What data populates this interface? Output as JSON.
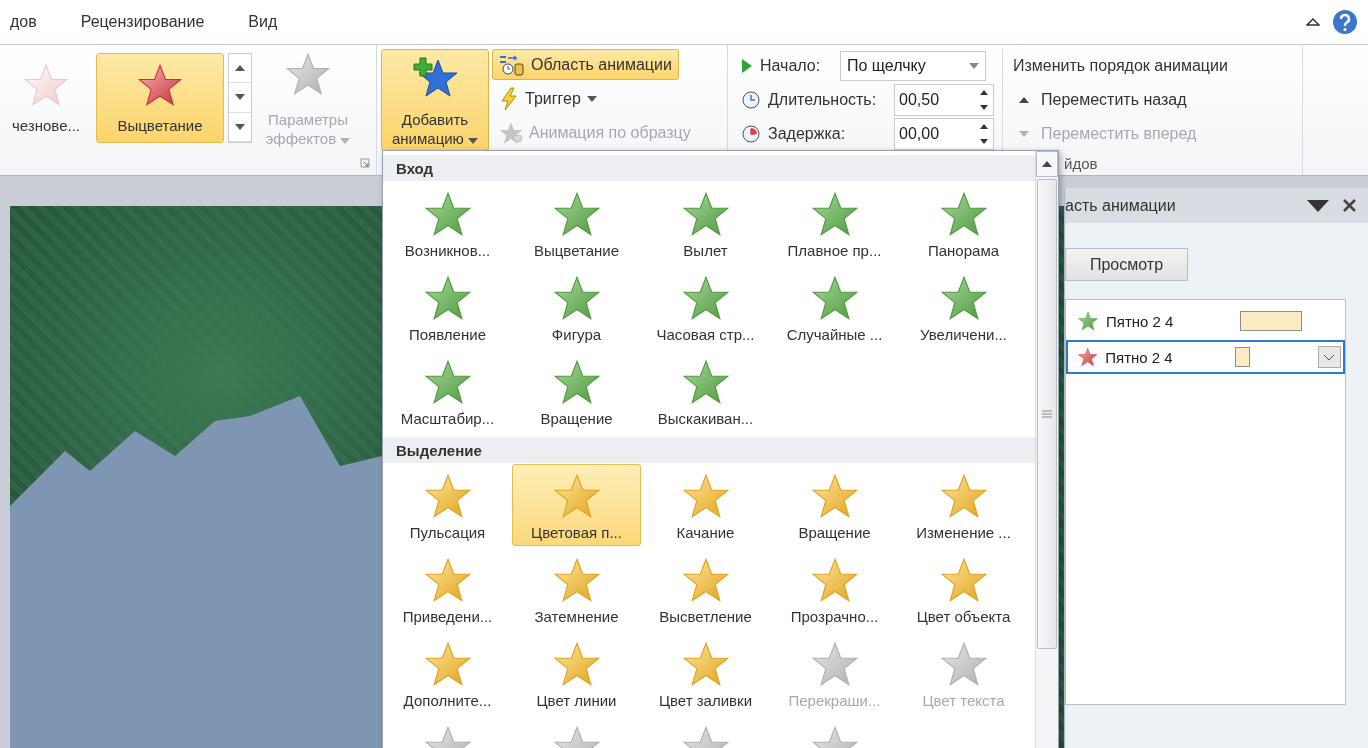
{
  "tabs": [
    "дов",
    "Рецензирование",
    "Вид"
  ],
  "effect_gallery": {
    "items": [
      {
        "label": "чезнове...",
        "selected": false
      },
      {
        "label": "Выцветание",
        "selected": true
      }
    ]
  },
  "effect_options": {
    "lines": [
      "Параметры",
      "эффектов"
    ],
    "disabled": true
  },
  "add_animation": {
    "lines": [
      "Добавить",
      "анимацию"
    ],
    "pressed": true
  },
  "advanced": [
    {
      "kind": "pane",
      "label": "Область анимации",
      "active": true,
      "disabled": false
    },
    {
      "kind": "trigger",
      "label": "Триггер",
      "active": false,
      "disabled": false
    },
    {
      "kind": "painter",
      "label": "Анимация по образцу",
      "active": false,
      "disabled": true
    }
  ],
  "timing": {
    "start": {
      "label": "Начало:",
      "value": "По щелчку"
    },
    "duration": {
      "label": "Длительность:",
      "value": "00,50"
    },
    "delay": {
      "label": "Задержка:",
      "value": "00,00"
    },
    "group_label": "йдов"
  },
  "reorder": {
    "title": "Изменить порядок анимации",
    "buttons": [
      {
        "label": "Переместить назад",
        "disabled": false
      },
      {
        "label": "Переместить вперед",
        "disabled": true
      }
    ]
  },
  "gallery": {
    "sections": [
      {
        "title": "Вход",
        "kind": "entrance",
        "items": [
          {
            "label": "Возникнов...",
            "selected": false,
            "disabled": false
          },
          {
            "label": "Выцветание",
            "selected": false,
            "disabled": false
          },
          {
            "label": "Вылет",
            "selected": false,
            "disabled": false
          },
          {
            "label": "Плавное пр...",
            "selected": false,
            "disabled": false
          },
          {
            "label": "Панорама",
            "selected": false,
            "disabled": false
          },
          {
            "label": "Появление",
            "selected": false,
            "disabled": false
          },
          {
            "label": "Фигура",
            "selected": false,
            "disabled": false
          },
          {
            "label": "Часовая стр...",
            "selected": false,
            "disabled": false
          },
          {
            "label": "Случайные ...",
            "selected": false,
            "disabled": false
          },
          {
            "label": "Увеличени...",
            "selected": false,
            "disabled": false
          },
          {
            "label": "Масштабир...",
            "selected": false,
            "disabled": false
          },
          {
            "label": "Вращение",
            "selected": false,
            "disabled": false
          },
          {
            "label": "Выскакиван...",
            "selected": false,
            "disabled": false
          }
        ]
      },
      {
        "title": "Выделение",
        "kind": "emphasis",
        "items": [
          {
            "label": "Пульсация",
            "selected": false,
            "disabled": false
          },
          {
            "label": "Цветовая п...",
            "selected": true,
            "disabled": false
          },
          {
            "label": "Качание",
            "selected": false,
            "disabled": false
          },
          {
            "label": "Вращение",
            "selected": false,
            "disabled": false
          },
          {
            "label": "Изменение ...",
            "selected": false,
            "disabled": false
          },
          {
            "label": "Приведени...",
            "selected": false,
            "disabled": false
          },
          {
            "label": "Затемнение",
            "selected": false,
            "disabled": false
          },
          {
            "label": "Высветление",
            "selected": false,
            "disabled": false
          },
          {
            "label": "Прозрачно...",
            "selected": false,
            "disabled": false
          },
          {
            "label": "Цвет объекта",
            "selected": false,
            "disabled": false
          },
          {
            "label": "Дополните...",
            "selected": false,
            "disabled": false
          },
          {
            "label": "Цвет линии",
            "selected": false,
            "disabled": false
          },
          {
            "label": "Цвет заливки",
            "selected": false,
            "disabled": false
          },
          {
            "label": "Перекраши...",
            "selected": false,
            "disabled": true
          },
          {
            "label": "Цвет текста",
            "selected": false,
            "disabled": true
          },
          {
            "selected": false,
            "disabled": true
          },
          {
            "selected": false,
            "disabled": true
          },
          {
            "selected": false,
            "disabled": true
          },
          {
            "selected": false,
            "disabled": true
          }
        ]
      }
    ]
  },
  "animation_pane": {
    "title": "асть анимации",
    "preview_button": "Просмотр",
    "items": [
      {
        "kind": "entrance",
        "name": "Пятно 2 4",
        "bar": {
          "kind": "long"
        },
        "selected": false
      },
      {
        "kind": "emphasis",
        "name": "Пятно 2 4",
        "bar": {
          "kind": "short"
        },
        "selected": true
      }
    ]
  }
}
